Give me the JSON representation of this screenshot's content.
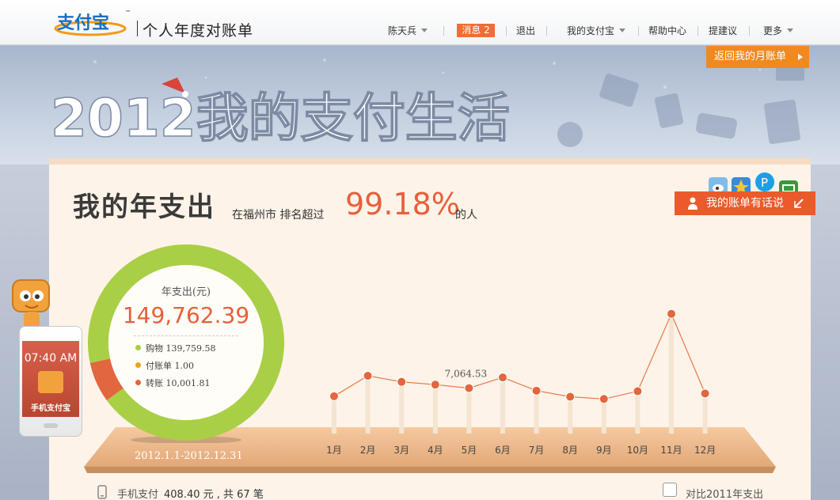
{
  "header": {
    "brand": "支付宝",
    "brand_tm": "™",
    "site_title": "个人年度对账单",
    "user_name": "陈天兵",
    "messages_label": "消息 2",
    "logout": "退出",
    "my_alipay": "我的支付宝",
    "help": "帮助中心",
    "suggest": "提建议",
    "more": "更多"
  },
  "banner": {
    "headline": "2012我的支付生活",
    "return_label": "返回我的月账单"
  },
  "summary": {
    "title": "我的年支出",
    "city_text": "在福州市 排名超过",
    "percent": "99.18%",
    "tail": "的人",
    "talk_label": "我的账单有话说"
  },
  "donut": {
    "label": "年支出(元)",
    "total": "149,762.39",
    "date_range": "2012.1.1-2012.12.31",
    "segments": [
      {
        "name": "购物",
        "amount": "139,759.58",
        "value": 139759.58,
        "color": "#a9cf46"
      },
      {
        "name": "付账单",
        "amount": "1.00",
        "value": 1.0,
        "color": "#f0a020"
      },
      {
        "name": "转账",
        "amount": "10,001.81",
        "value": 10001.81,
        "color": "#e2663e"
      }
    ]
  },
  "chart_data": {
    "type": "line",
    "categories": [
      "1月",
      "2月",
      "3月",
      "4月",
      "5月",
      "6月",
      "7月",
      "8月",
      "9月",
      "10月",
      "11月",
      "12月"
    ],
    "series": [
      {
        "values": [
          5600,
          9300,
          8200,
          7700,
          7064.53,
          9000,
          6600,
          5500,
          5100,
          6500,
          55000,
          6100
        ]
      }
    ],
    "annotations": [
      {
        "category": "5月",
        "text": "7,064.53"
      }
    ],
    "ylim": [
      0,
      60000
    ],
    "line_color": "#e8784a",
    "point_color": "#e2663e"
  },
  "footer": {
    "mobile_text": "手机支付",
    "mobile_amount": "408.40 元 , 共 67 笔",
    "compare_label": "对比2011年支出"
  },
  "phone": {
    "time": "07:40 AM",
    "app_label": "手机支付宝"
  },
  "icons": {
    "weibo": "weibo-icon",
    "qzone": "qzone-icon",
    "pengyou": "pengyou-icon",
    "douban": "douban-icon"
  }
}
